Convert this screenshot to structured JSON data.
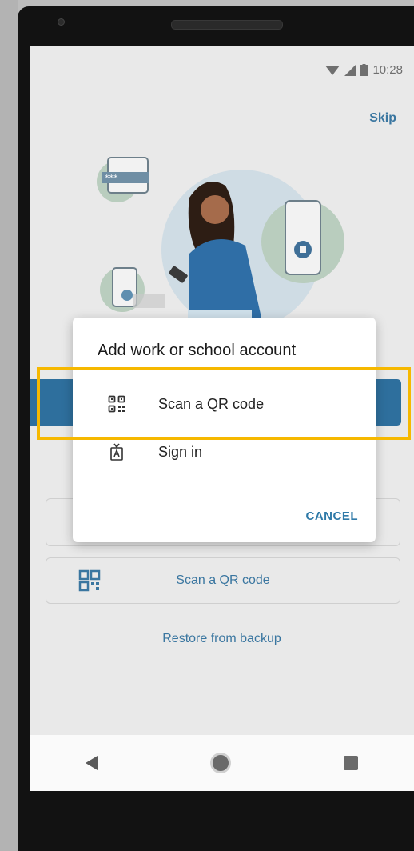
{
  "status_bar": {
    "time": "10:28"
  },
  "onboarding": {
    "skip_label": "Skip",
    "scan_qr_label": "Scan a QR code",
    "restore_label": "Restore from backup"
  },
  "dialog": {
    "title": "Add work or school account",
    "options": [
      {
        "label": "Scan a QR code",
        "icon": "qr-code-icon"
      },
      {
        "label": "Sign in",
        "icon": "badge-icon"
      }
    ],
    "cancel_label": "CANCEL"
  },
  "colors": {
    "accent": "#2e6f9d",
    "link": "#3a76a0",
    "highlight": "#f6b800"
  }
}
